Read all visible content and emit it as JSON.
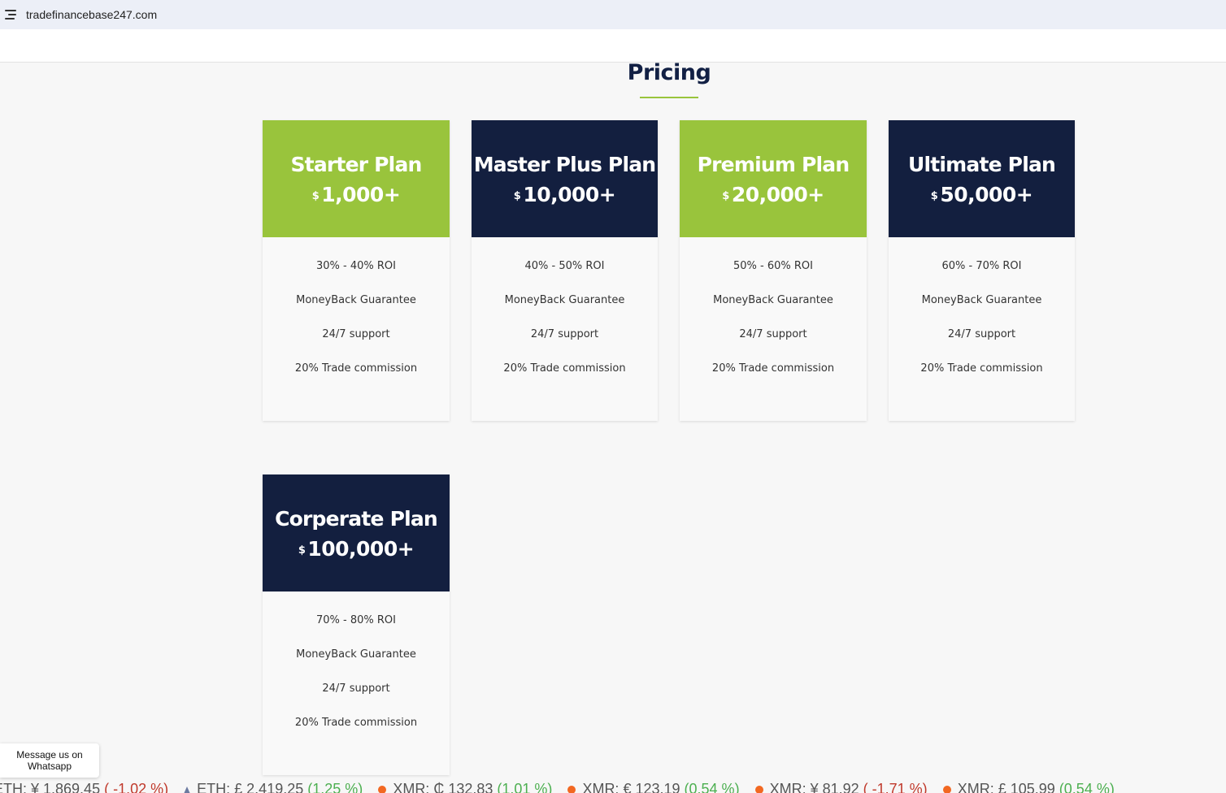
{
  "browser": {
    "url": "tradefinancebase247.com"
  },
  "section": {
    "title": "Pricing"
  },
  "plans": [
    {
      "name": "Starter Plan",
      "currency": "$",
      "price": "1,000+",
      "color": "#99c43c",
      "features": [
        "30% - 40% ROI",
        "MoneyBack Guarantee",
        "24/7 support",
        "20% Trade commission"
      ]
    },
    {
      "name": "Master Plus Plan",
      "currency": "$",
      "price": "10,000+",
      "color": "#131f3f",
      "features": [
        "40% - 50% ROI",
        "MoneyBack Guarantee",
        "24/7 support",
        "20% Trade commission"
      ]
    },
    {
      "name": "Premium Plan",
      "currency": "$",
      "price": "20,000+",
      "color": "#99c43c",
      "features": [
        "50% - 60% ROI",
        "MoneyBack Guarantee",
        "24/7 support",
        "20% Trade commission"
      ]
    },
    {
      "name": "Ultimate Plan",
      "currency": "$",
      "price": "50,000+",
      "color": "#131f3f",
      "features": [
        "60% - 70% ROI",
        "MoneyBack Guarantee",
        "24/7 support",
        "20% Trade commission"
      ]
    },
    {
      "name": "Corperate Plan",
      "currency": "$",
      "price": "100,000+",
      "color": "#131f3f",
      "features": [
        "70% - 80% ROI",
        "MoneyBack Guarantee",
        "24/7 support",
        "20% Trade commission"
      ]
    }
  ],
  "whatsapp": {
    "line1": "Message us on",
    "line2": "Whatsapp"
  },
  "ticker": [
    {
      "icon": "none",
      "label": "ETH: ¥ 1,869.45",
      "change": "( -1.02 %)",
      "trend": "neg"
    },
    {
      "icon": "eth-icon",
      "label": "ETH: £ 2,419.25",
      "change": "(1.25 %)",
      "trend": "pos"
    },
    {
      "icon": "xmr-icon",
      "label": "XMR: ₵ 132.83",
      "change": "(1.01 %)",
      "trend": "pos"
    },
    {
      "icon": "xmr-icon",
      "label": "XMR: € 123.19",
      "change": "(0.54 %)",
      "trend": "pos"
    },
    {
      "icon": "xmr-icon",
      "label": "XMR: ¥ 81.92",
      "change": "( -1.71 %)",
      "trend": "neg"
    },
    {
      "icon": "xmr-icon",
      "label": "XMR: £ 105.99",
      "change": "(0.54 %)",
      "trend": "pos"
    }
  ],
  "colors": {
    "accent_green": "#99c43c",
    "navy": "#131f3f",
    "background": "#f7f7f7"
  }
}
